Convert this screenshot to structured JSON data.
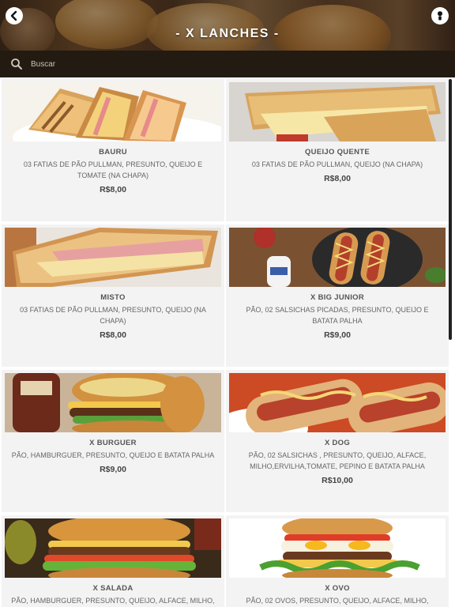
{
  "header": {
    "title": "- X LANCHES -",
    "back_icon": "chevron-left-icon",
    "info_icon": "info-icon"
  },
  "search": {
    "placeholder": "Buscar",
    "value": "",
    "icon": "search-icon"
  },
  "products": [
    {
      "name": "BAURU",
      "description": "03 FATIAS DE PÃO PULLMAN, PRESUNTO, QUEIJO E TOMATE (NA CHAPA)",
      "price": "R$8,00",
      "image": "toasted-sandwich"
    },
    {
      "name": "QUEIJO QUENTE",
      "description": "03 FATIAS DE PÃO PULLMAN, QUEIJO (NA CHAPA)",
      "price": "R$8,00",
      "image": "grilled-cheese"
    },
    {
      "name": "MISTO",
      "description": "03 FATIAS DE PÃO PULLMAN, PRESUNTO, QUEIJO (NA CHAPA)",
      "price": "R$8,00",
      "image": "ham-cheese-toast"
    },
    {
      "name": "X BIG JUNIOR",
      "description": "PÃO, 02 SALSICHAS PICADAS, PRESUNTO, QUEIJO E BATATA PALHA",
      "price": "R$9,00",
      "image": "hot-dog-sauces"
    },
    {
      "name": "X BURGUER",
      "description": "PÃO, HAMBURGUER, PRESUNTO, QUEIJO E BATATA PALHA",
      "price": "R$9,00",
      "image": "burger"
    },
    {
      "name": "X DOG",
      "description": "PÃO, 02 SALSICHAS , PRESUNTO, QUEIJO, ALFACE, MILHO,ERVILHA,TOMATE, PEPINO E BATATA PALHA",
      "price": "R$10,00",
      "image": "hot-dogs"
    },
    {
      "name": "X SALADA",
      "description": "PÃO, HAMBURGUER, PRESUNTO, QUEIJO, ALFACE, MILHO,",
      "price": "",
      "image": "salad-burger"
    },
    {
      "name": "X OVO",
      "description": "PÃO, 02 OVOS, PRESUNTO, QUEIJO, ALFACE, MILHO,",
      "price": "",
      "image": "egg-burger"
    }
  ],
  "colors": {
    "search_bg": "#231a12",
    "card_bg": "#f3f3f4",
    "header_text": "#ffffff"
  }
}
